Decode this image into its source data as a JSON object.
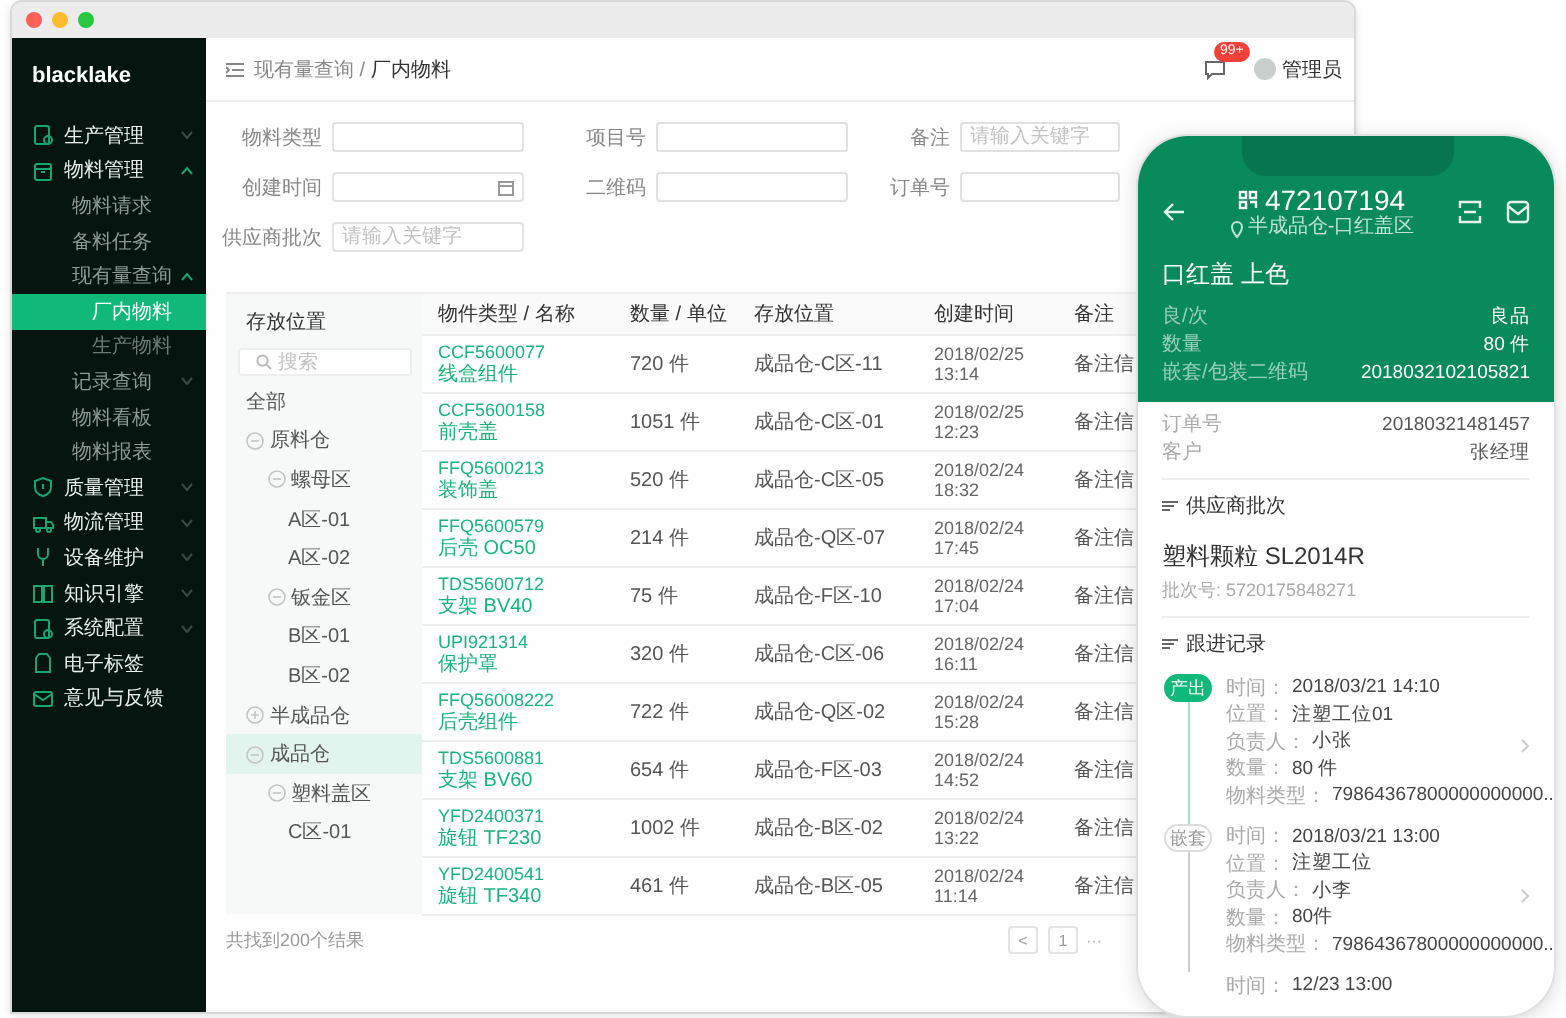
{
  "sidebar": {
    "logo": "blacklake",
    "items": [
      {
        "label": "生产管理",
        "expanded": false,
        "selected": false
      },
      {
        "label": "物料管理",
        "expanded": true,
        "selected": false,
        "children": [
          {
            "label": "物料请求",
            "selected": false
          },
          {
            "label": "备料任务",
            "selected": false
          },
          {
            "label": "现有量查询",
            "expanded": true,
            "selected": false,
            "children": [
              {
                "label": "厂内物料",
                "selected": true
              },
              {
                "label": "生产物料",
                "selected": false
              }
            ]
          },
          {
            "label": "记录查询",
            "expanded": false,
            "selected": false
          },
          {
            "label": "物料看板",
            "selected": false
          },
          {
            "label": "物料报表",
            "selected": false
          }
        ]
      },
      {
        "label": "质量管理",
        "expanded": false,
        "selected": false
      },
      {
        "label": "物流管理",
        "expanded": false,
        "selected": false
      },
      {
        "label": "设备维护",
        "expanded": false,
        "selected": false
      },
      {
        "label": "知识引擎",
        "expanded": false,
        "selected": false
      },
      {
        "label": "系统配置",
        "expanded": false,
        "selected": false
      },
      {
        "label": "电子标签",
        "selected": false
      },
      {
        "label": "意见与反馈",
        "selected": false
      }
    ]
  },
  "header": {
    "breadcrumb": "现有量查询 / **厂内物料**",
    "notification_badge": "99+",
    "user": "管理员"
  },
  "filters": [
    {
      "label": "物料类型",
      "kind": "text"
    },
    {
      "label": "项目号",
      "kind": "text"
    },
    {
      "label": "备注",
      "kind": "text",
      "placeholder": "请输入关键字"
    },
    {
      "label": "创建时间",
      "kind": "date"
    },
    {
      "label": "二维码",
      "kind": "text"
    },
    {
      "label": "订单号",
      "kind": "text"
    },
    {
      "label": "供应商批次",
      "kind": "text",
      "placeholder": "请输入关键字"
    }
  ],
  "location_tree": {
    "title": "存放位置",
    "search_placeholder": "搜索",
    "nodes": [
      {
        "label": "全部",
        "selected": false
      },
      {
        "label": "原料仓",
        "expanded": true,
        "selected": false,
        "children": [
          {
            "label": "螺母区",
            "expanded": true,
            "selected": false,
            "children": [
              {
                "label": "A区-01",
                "selected": false
              },
              {
                "label": "A区-02",
                "selected": false
              }
            ]
          },
          {
            "label": "钣金区",
            "expanded": true,
            "selected": false,
            "children": [
              {
                "label": "B区-01",
                "selected": false
              },
              {
                "label": "B区-02",
                "selected": false
              }
            ]
          }
        ]
      },
      {
        "label": "半成品仓",
        "expanded": false,
        "selected": false
      },
      {
        "label": "成品仓",
        "expanded": true,
        "selected": true,
        "children": [
          {
            "label": "塑料盖区",
            "expanded": true,
            "selected": false,
            "children": [
              {
                "label": "C区-01",
                "selected": false
              }
            ]
          }
        ]
      }
    ]
  },
  "table": {
    "columns": [
      "物件类型 / 名称",
      "数量 / 单位",
      "存放位置",
      "创建时间",
      "备注"
    ],
    "rows": [
      {
        "code": "CCF5600077",
        "name": "线盒组件",
        "quantity": "720 件",
        "location": "成品仓-C区-11",
        "created": "2018/02/25 13:14",
        "note": "备注信"
      },
      {
        "code": "CCF5600158",
        "name": "前壳盖",
        "quantity": "1051 件",
        "location": "成品仓-C区-01",
        "created": "2018/02/25 12:23",
        "note": "备注信"
      },
      {
        "code": "FFQ5600213",
        "name": "装饰盖",
        "quantity": "520 件",
        "location": "成品仓-C区-05",
        "created": "2018/02/24 18:32",
        "note": "备注信"
      },
      {
        "code": "FFQ5600579",
        "name": "后壳 OC50",
        "quantity": "214 件",
        "location": "成品仓-Q区-07",
        "created": "2018/02/24 17:45",
        "note": "备注信"
      },
      {
        "code": "TDS5600712",
        "name": "支架 BV40",
        "quantity": "75 件",
        "location": "成品仓-F区-10",
        "created": "2018/02/24 17:04",
        "note": "备注信"
      },
      {
        "code": "UPI921314",
        "name": "保护罩",
        "quantity": "320 件",
        "location": "成品仓-C区-06",
        "created": "2018/02/24 16:11",
        "note": "备注信"
      },
      {
        "code": "FFQ56008222",
        "name": "后壳组件",
        "quantity": "722 件",
        "location": "成品仓-Q区-02",
        "created": "2018/02/24 15:28",
        "note": "备注信"
      },
      {
        "code": "TDS5600881",
        "name": "支架 BV60",
        "quantity": "654 件",
        "location": "成品仓-F区-03",
        "created": "2018/02/24 14:52",
        "note": "备注信"
      },
      {
        "code": "YFD2400371",
        "name": "旋钮 TF230",
        "quantity": "1002 件",
        "location": "成品仓-B区-02",
        "created": "2018/02/24 13:22",
        "note": "备注信"
      },
      {
        "code": "YFD2400541",
        "name": "旋钮 TF340",
        "quantity": "461 件",
        "location": "成品仓-B区-05",
        "created": "2018/02/24 11:14",
        "note": "备注信"
      }
    ]
  },
  "footer": {
    "summary": "共找到200个结果",
    "prev": "<",
    "pages": [
      {
        "label": "1",
        "selected": false
      }
    ],
    "ellipsis": "···"
  },
  "phone": {
    "code": "472107194",
    "location": "半成品仓-口红盖区",
    "title": "口红盖 上色",
    "header_fields": [
      {
        "label": "良/次",
        "value": "良品"
      },
      {
        "label": "数量",
        "value": "80 件"
      },
      {
        "label": "嵌套/包装二维码",
        "value": "2018032102105821"
      }
    ],
    "fields": [
      {
        "label": "订单号",
        "value": "20180321481457"
      },
      {
        "label": "客户",
        "value": "张经理"
      }
    ],
    "supplier": {
      "heading": "供应商批次",
      "name": "塑料颗粒 SL2014R",
      "batch": "批次号: 5720175848271"
    },
    "records": {
      "heading": "跟进记录",
      "entries": [
        {
          "tag": "产出",
          "active": true,
          "fields": [
            {
              "label": "时间：",
              "value": "2018/03/21 14:10"
            },
            {
              "label": "位置：",
              "value": "注塑工位01"
            },
            {
              "label": "负责人：",
              "value": "小张"
            },
            {
              "label": "数量：",
              "value": "80 件"
            },
            {
              "label": "物料类型：",
              "value": "79864367800000000000..."
            }
          ]
        },
        {
          "tag": "嵌套",
          "active": false,
          "fields": [
            {
              "label": "时间：",
              "value": "2018/03/21 13:00"
            },
            {
              "label": "位置：",
              "value": "注塑工位"
            },
            {
              "label": "负责人：",
              "value": "小李"
            },
            {
              "label": "数量：",
              "value": "80件"
            },
            {
              "label": "物料类型：",
              "value": "79864367800000000000..."
            }
          ]
        },
        {
          "fields": [
            {
              "label": "时间：",
              "value": "12/23 13:00"
            }
          ]
        }
      ]
    }
  }
}
